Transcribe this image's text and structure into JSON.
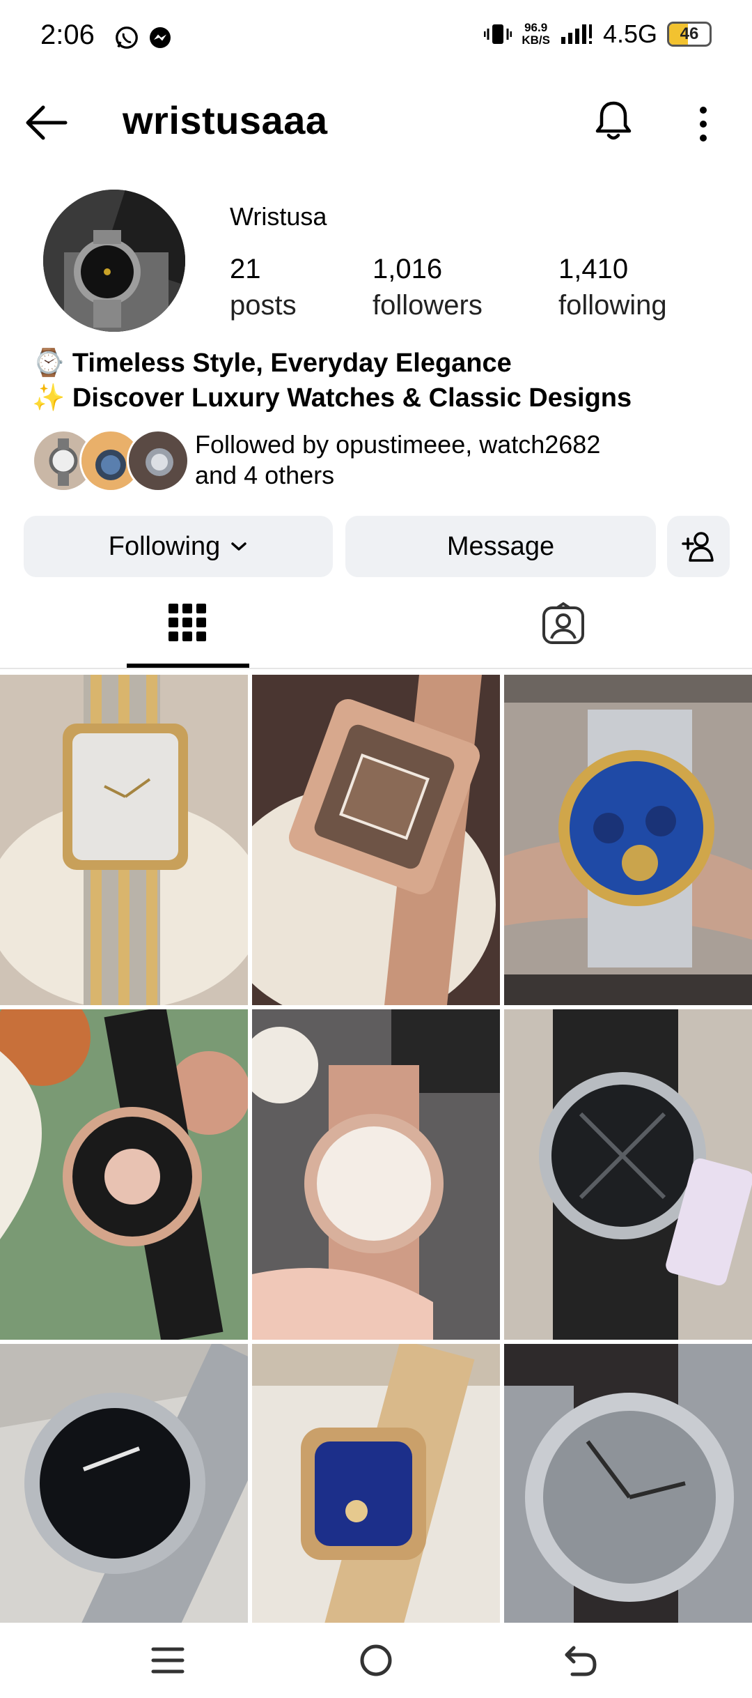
{
  "status_bar": {
    "time": "2:06",
    "net_speed_value": "96.9",
    "net_speed_unit": "KB/S",
    "network": "4.5G",
    "battery": "46",
    "battery_level": 0.46,
    "app_icons": [
      "whatsapp-icon",
      "messenger-icon"
    ]
  },
  "header": {
    "username": "wristusaaa"
  },
  "profile": {
    "display_name": "Wristusa",
    "stats": {
      "posts_count": "21",
      "posts_label": "posts",
      "followers_count": "1,016",
      "followers_label": "followers",
      "following_count": "1,410",
      "following_label": "following"
    },
    "bio": [
      {
        "emoji": "⌚",
        "text": "Timeless Style, Everyday Elegance"
      },
      {
        "emoji": "✨",
        "text": "Discover Luxury Watches & Classic Designs"
      }
    ],
    "followed_by_line1": "Followed by opustimeee, watch2682",
    "followed_by_line2": "and 4 others"
  },
  "actions": {
    "following_label": "Following",
    "message_label": "Message"
  },
  "tabs": [
    {
      "name": "posts-grid",
      "icon": "grid-icon",
      "active": true
    },
    {
      "name": "tagged",
      "icon": "tagged-person-icon",
      "active": false
    }
  ],
  "posts": [
    {
      "watch": "silver-gold rectangular watch"
    },
    {
      "watch": "rose gold square watch"
    },
    {
      "watch": "blue skeleton chronograph"
    },
    {
      "watch": "rose gold black leather watch"
    },
    {
      "watch": "rose gold round watch"
    },
    {
      "watch": "black dial leather watch"
    },
    {
      "watch": "black dial silver watch"
    },
    {
      "watch": "blue dial gold watch"
    },
    {
      "watch": "grey dial steel watch"
    }
  ],
  "colors": {
    "button_bg": "#eff1f4",
    "text": "#000000",
    "battery_fill": "#f2c230"
  }
}
